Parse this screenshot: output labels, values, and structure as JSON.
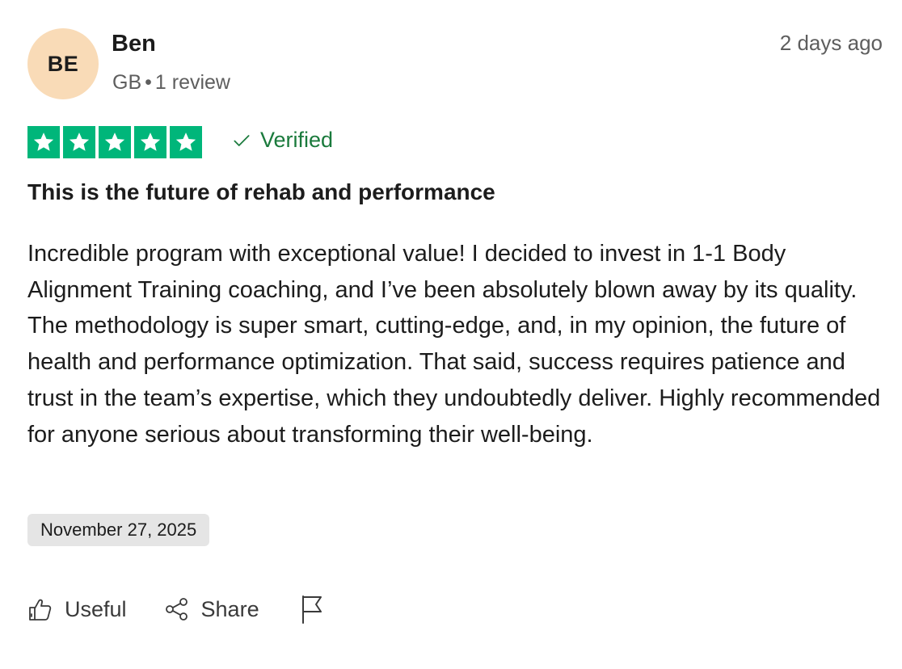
{
  "reviewer": {
    "initials": "BE",
    "name": "Ben",
    "country": "GB",
    "separator": "•",
    "review_count": "1 review"
  },
  "posted_ago": "2 days ago",
  "rating": {
    "value": 5,
    "max": 5,
    "star_color": "#00b67a"
  },
  "verified_label": "Verified",
  "review": {
    "title": "This is the future of rehab and performance",
    "body": "Incredible program with exceptional value! I decided to invest in 1-1 Body Alignment Training coaching, and I’ve been absolutely blown away by its quality. The methodology is super smart, cutting-edge, and, in my opinion, the future of health and performance optimization. That said, success requires patience and trust in the team’s expertise, which they undoubtedly deliver. Highly recommended for anyone serious about transforming their well-being.",
    "experience_date": "November 27, 2025"
  },
  "actions": {
    "useful_label": "Useful",
    "share_label": "Share",
    "icons": [
      "thumbs-up-icon",
      "share-icon",
      "flag-icon"
    ]
  }
}
